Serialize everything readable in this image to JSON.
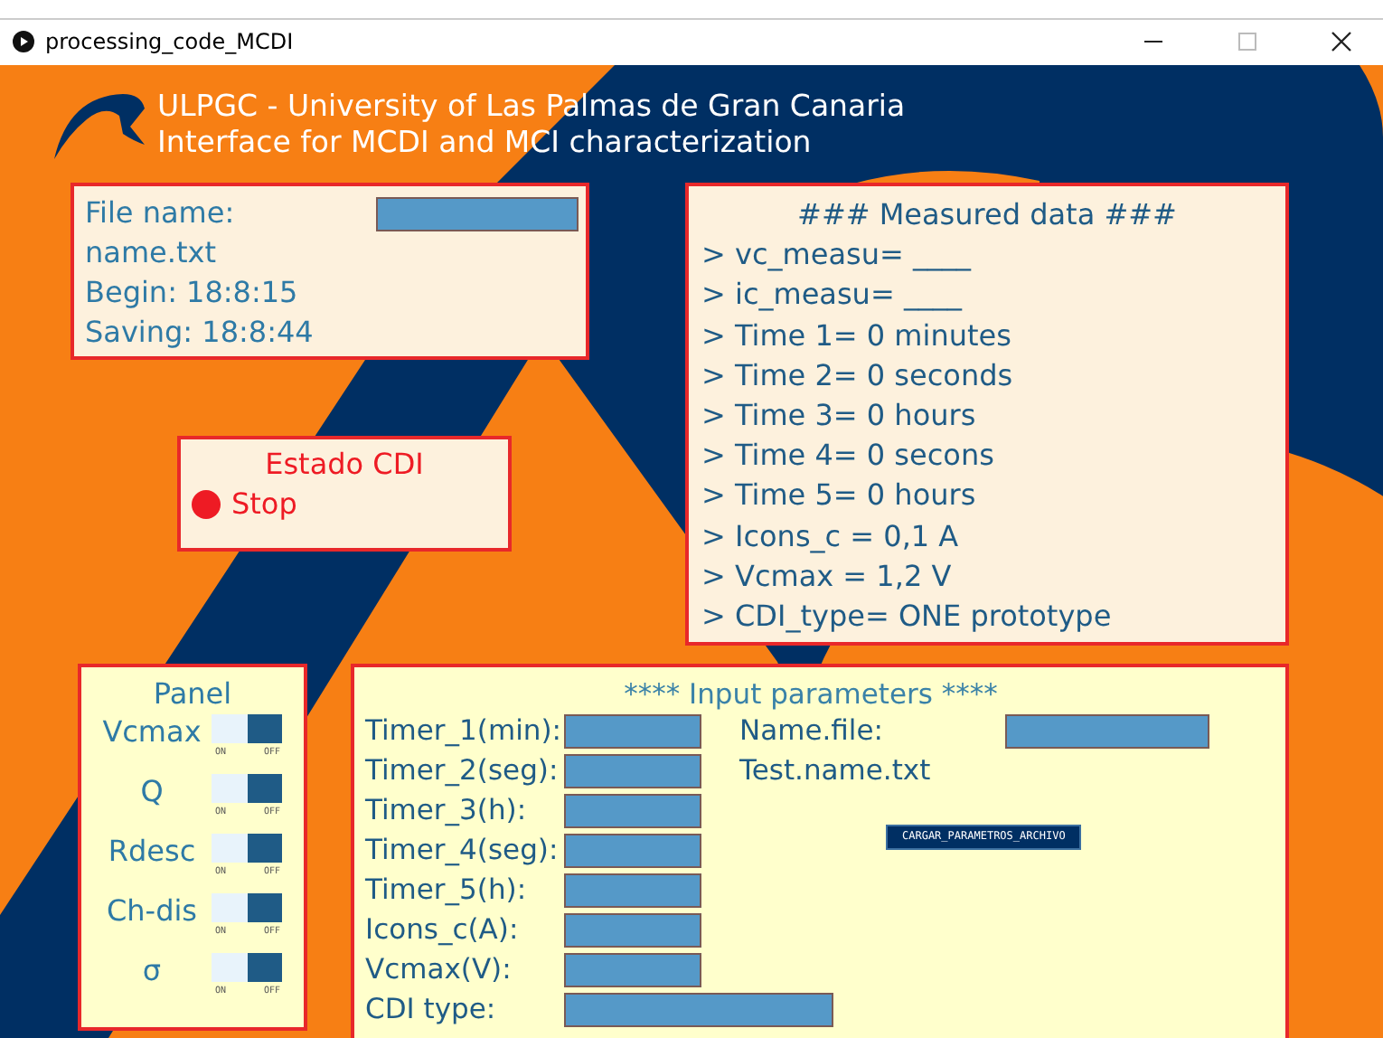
{
  "window": {
    "title": "processing_code_MCDI"
  },
  "header": {
    "lines": [
      "ULPGC - University of Las Palmas de Gran Canaria",
      "Interface for MCDI and MCI characterization"
    ]
  },
  "file_panel": {
    "label": "File name:",
    "file_name": "name.txt",
    "begin": "Begin: 18:8:15",
    "saving": "Saving: 18:8:44"
  },
  "status_panel": {
    "title": "Estado CDI",
    "running": false,
    "state": "Stop"
  },
  "measured": {
    "title": "### Measured data ###",
    "lines": [
      "> vc_measu= ____",
      "> ic_measu= ____",
      "> Time 1= 0 minutes",
      "> Time 2= 0 seconds",
      "> Time 3= 0 hours",
      "> Time 4= 0 secons",
      "> Time 5= 0 hours",
      "> Icons_c = 0,1 A",
      "> Vcmax = 1,2 V",
      "> CDI_type= ONE prototype"
    ]
  },
  "panel": {
    "title": "Panel",
    "toggles": [
      {
        "label": "Vcmax",
        "on": false,
        "on_label": "ON",
        "off_label": "OFF"
      },
      {
        "label": "Q",
        "on": false,
        "on_label": "ON",
        "off_label": "OFF"
      },
      {
        "label": "Rdesc",
        "on": false,
        "on_label": "ON",
        "off_label": "OFF"
      },
      {
        "label": "Ch-dis",
        "on": false,
        "on_label": "ON",
        "off_label": "OFF"
      },
      {
        "label": "σ",
        "on": false,
        "on_label": "ON",
        "off_label": "OFF"
      }
    ]
  },
  "input": {
    "title": "**** Input parameters ****",
    "fields": [
      {
        "label": "Timer_1(min):",
        "kind": "short"
      },
      {
        "label": "Timer_2(seg):",
        "kind": "short"
      },
      {
        "label": "Timer_3(h):",
        "kind": "short"
      },
      {
        "label": "Timer_4(seg):",
        "kind": "short"
      },
      {
        "label": "Timer_5(h):",
        "kind": "short"
      },
      {
        "label": "Icons_c(A):",
        "kind": "short"
      },
      {
        "label": "Vcmax(V):",
        "kind": "short"
      },
      {
        "label": "CDI type:",
        "kind": "long"
      }
    ],
    "name_label": "Name.file:",
    "name_value": "Test.name.txt",
    "button": "CARGAR_PARAMETROS_ARCHIVO"
  }
}
